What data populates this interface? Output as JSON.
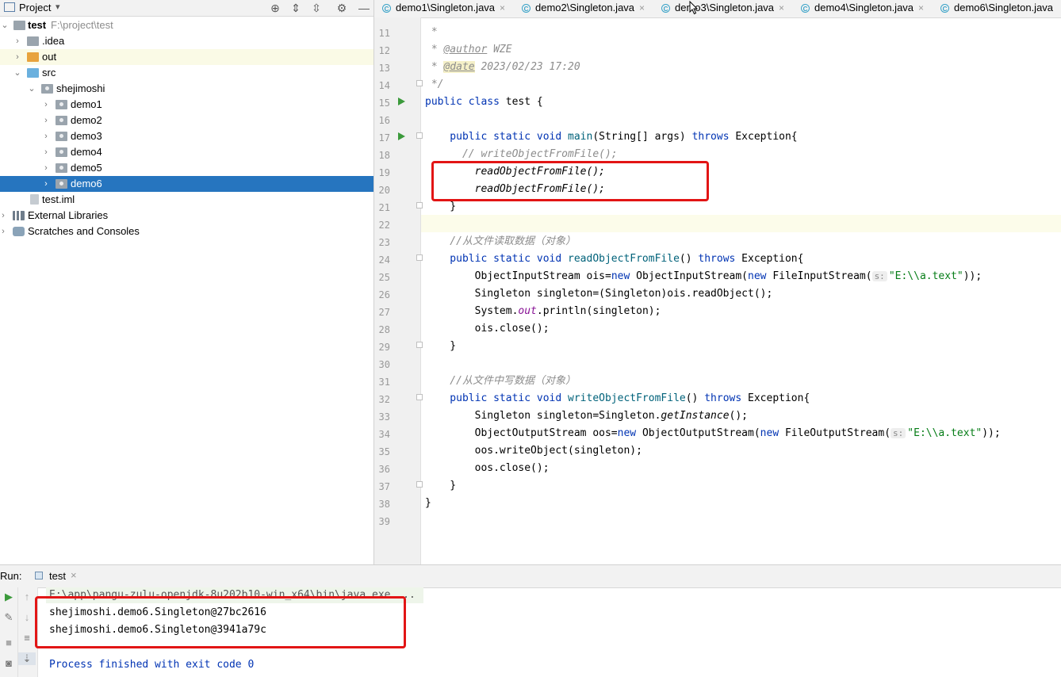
{
  "project_panel": {
    "title": "Project",
    "tree": [
      {
        "label": "test",
        "path": "F:\\project\\test",
        "arrow": "⌄",
        "icon": "folder-icon"
      },
      {
        "label": ".idea",
        "arrow": "›",
        "icon": "folder-icon"
      },
      {
        "label": "out",
        "arrow": "›",
        "icon": "folder-icon"
      },
      {
        "label": "src",
        "arrow": "⌄",
        "icon": "folder-icon"
      },
      {
        "label": "shejimoshi",
        "arrow": "⌄",
        "icon": "package-icon"
      },
      {
        "label": "demo1",
        "arrow": "›",
        "icon": "package-icon"
      },
      {
        "label": "demo2",
        "arrow": "›",
        "icon": "package-icon"
      },
      {
        "label": "demo3",
        "arrow": "›",
        "icon": "package-icon"
      },
      {
        "label": "demo4",
        "arrow": "›",
        "icon": "package-icon"
      },
      {
        "label": "demo5",
        "arrow": "›",
        "icon": "package-icon"
      },
      {
        "label": "demo6",
        "arrow": "›",
        "icon": "package-icon"
      },
      {
        "label": "test.iml",
        "arrow": "",
        "icon": "iml-file-icon"
      },
      {
        "label": "External Libraries",
        "arrow": "›",
        "icon": "library-icon"
      },
      {
        "label": "Scratches and Consoles",
        "arrow": "›",
        "icon": "scratches-icon"
      }
    ]
  },
  "editor": {
    "tabs": [
      {
        "label": "demo1\\Singleton.java"
      },
      {
        "label": "demo2\\Singleton.java"
      },
      {
        "label": "demo3\\Singleton.java"
      },
      {
        "label": "demo4\\Singleton.java"
      },
      {
        "label": "demo6\\Singleton.java"
      }
    ],
    "line_numbers": [
      "11",
      "12",
      "13",
      "14",
      "15",
      "16",
      "17",
      "18",
      "19",
      "20",
      "21",
      "22",
      "23",
      "24",
      "25",
      "26",
      "27",
      "28",
      "29",
      "30",
      "31",
      "32",
      "33",
      "34",
      "35",
      "36",
      "37",
      "38",
      "39"
    ],
    "code": {
      "l11": " *",
      "l12_prefix": " * ",
      "l12_tag": "@author",
      "l12_rest": " WZE",
      "l13_prefix": " * ",
      "l13_tag": "@date",
      "l13_rest": " 2023/02/23 17:20",
      "l14": " */",
      "l15_kw": "public class",
      "l15_rest": " test {",
      "l17_kw": "    public static void",
      "l17_name": " main",
      "l17_mid": "(String[] args) ",
      "l17_kw2": "throws",
      "l17_rest": " Exception{",
      "l18": "      // writeObjectFromFile();",
      "l19": "        readObjectFromFile();",
      "l20": "        readObjectFromFile();",
      "l21": "    }",
      "l23": "    //从文件读取数据（对象）",
      "l24_kw": "    public static void",
      "l24_name": " readObjectFromFile",
      "l24_mid": "() ",
      "l24_kw2": "throws",
      "l24_rest": " Exception{",
      "l25_a": "        ObjectInputStream ois=",
      "l25_kw": "new",
      "l25_b": " ObjectInputStream(",
      "l25_kw2": "new",
      "l25_c": " FileInputStream(",
      "l25_hint": "s:",
      "l25_str": "\"E:\\\\a.text\"",
      "l25_d": "));",
      "l26": "        Singleton singleton=(Singleton)ois.readObject();",
      "l27_a": "        System.",
      "l27_fld": "out",
      "l27_b": ".println(singleton);",
      "l28": "        ois.close();",
      "l29": "    }",
      "l31": "    //从文件中写数据（对象）",
      "l32_kw": "    public static void",
      "l32_name": " writeObjectFromFile",
      "l32_mid": "() ",
      "l32_kw2": "throws",
      "l32_rest": " Exception{",
      "l33_a": "        Singleton singleton=Singleton.",
      "l33_it": "getInstance",
      "l33_b": "();",
      "l34_a": "        ObjectOutputStream oos=",
      "l34_kw": "new",
      "l34_b": " ObjectOutputStream(",
      "l34_kw2": "new",
      "l34_c": " FileOutputStream(",
      "l34_hint": "s:",
      "l34_str": "\"E:\\\\a.text\"",
      "l34_d": "));",
      "l35": "        oos.writeObject(singleton);",
      "l36": "        oos.close();",
      "l37": "    }",
      "l38": "}"
    }
  },
  "run_panel": {
    "label": "Run:",
    "tab_label": "test",
    "output": [
      "E:\\app\\pangu-zulu-openjdk-8u202b10-win_x64\\bin\\java.exe ...",
      "shejimoshi.demo6.Singleton@27bc2616",
      "shejimoshi.demo6.Singleton@3941a79c",
      "",
      "Process finished with exit code 0"
    ]
  },
  "colors": {
    "accent": "#2675bf",
    "highlight_box": "#e21515",
    "keyword": "#0033b3",
    "string": "#067d17"
  }
}
